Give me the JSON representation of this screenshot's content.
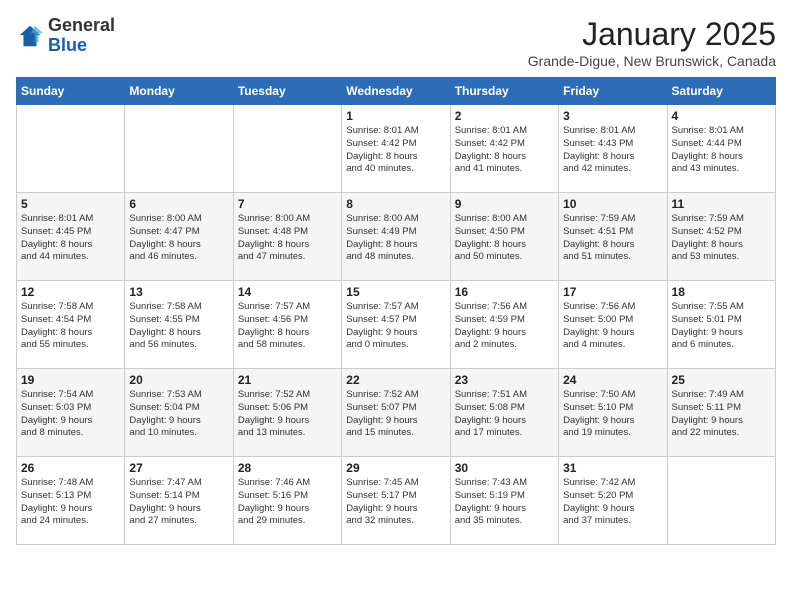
{
  "header": {
    "logo_general": "General",
    "logo_blue": "Blue",
    "month_title": "January 2025",
    "location": "Grande-Digue, New Brunswick, Canada"
  },
  "weekdays": [
    "Sunday",
    "Monday",
    "Tuesday",
    "Wednesday",
    "Thursday",
    "Friday",
    "Saturday"
  ],
  "weeks": [
    [
      {
        "day": "",
        "text": ""
      },
      {
        "day": "",
        "text": ""
      },
      {
        "day": "",
        "text": ""
      },
      {
        "day": "1",
        "text": "Sunrise: 8:01 AM\nSunset: 4:42 PM\nDaylight: 8 hours\nand 40 minutes."
      },
      {
        "day": "2",
        "text": "Sunrise: 8:01 AM\nSunset: 4:42 PM\nDaylight: 8 hours\nand 41 minutes."
      },
      {
        "day": "3",
        "text": "Sunrise: 8:01 AM\nSunset: 4:43 PM\nDaylight: 8 hours\nand 42 minutes."
      },
      {
        "day": "4",
        "text": "Sunrise: 8:01 AM\nSunset: 4:44 PM\nDaylight: 8 hours\nand 43 minutes."
      }
    ],
    [
      {
        "day": "5",
        "text": "Sunrise: 8:01 AM\nSunset: 4:45 PM\nDaylight: 8 hours\nand 44 minutes."
      },
      {
        "day": "6",
        "text": "Sunrise: 8:00 AM\nSunset: 4:47 PM\nDaylight: 8 hours\nand 46 minutes."
      },
      {
        "day": "7",
        "text": "Sunrise: 8:00 AM\nSunset: 4:48 PM\nDaylight: 8 hours\nand 47 minutes."
      },
      {
        "day": "8",
        "text": "Sunrise: 8:00 AM\nSunset: 4:49 PM\nDaylight: 8 hours\nand 48 minutes."
      },
      {
        "day": "9",
        "text": "Sunrise: 8:00 AM\nSunset: 4:50 PM\nDaylight: 8 hours\nand 50 minutes."
      },
      {
        "day": "10",
        "text": "Sunrise: 7:59 AM\nSunset: 4:51 PM\nDaylight: 8 hours\nand 51 minutes."
      },
      {
        "day": "11",
        "text": "Sunrise: 7:59 AM\nSunset: 4:52 PM\nDaylight: 8 hours\nand 53 minutes."
      }
    ],
    [
      {
        "day": "12",
        "text": "Sunrise: 7:58 AM\nSunset: 4:54 PM\nDaylight: 8 hours\nand 55 minutes."
      },
      {
        "day": "13",
        "text": "Sunrise: 7:58 AM\nSunset: 4:55 PM\nDaylight: 8 hours\nand 56 minutes."
      },
      {
        "day": "14",
        "text": "Sunrise: 7:57 AM\nSunset: 4:56 PM\nDaylight: 8 hours\nand 58 minutes."
      },
      {
        "day": "15",
        "text": "Sunrise: 7:57 AM\nSunset: 4:57 PM\nDaylight: 9 hours\nand 0 minutes."
      },
      {
        "day": "16",
        "text": "Sunrise: 7:56 AM\nSunset: 4:59 PM\nDaylight: 9 hours\nand 2 minutes."
      },
      {
        "day": "17",
        "text": "Sunrise: 7:56 AM\nSunset: 5:00 PM\nDaylight: 9 hours\nand 4 minutes."
      },
      {
        "day": "18",
        "text": "Sunrise: 7:55 AM\nSunset: 5:01 PM\nDaylight: 9 hours\nand 6 minutes."
      }
    ],
    [
      {
        "day": "19",
        "text": "Sunrise: 7:54 AM\nSunset: 5:03 PM\nDaylight: 9 hours\nand 8 minutes."
      },
      {
        "day": "20",
        "text": "Sunrise: 7:53 AM\nSunset: 5:04 PM\nDaylight: 9 hours\nand 10 minutes."
      },
      {
        "day": "21",
        "text": "Sunrise: 7:52 AM\nSunset: 5:06 PM\nDaylight: 9 hours\nand 13 minutes."
      },
      {
        "day": "22",
        "text": "Sunrise: 7:52 AM\nSunset: 5:07 PM\nDaylight: 9 hours\nand 15 minutes."
      },
      {
        "day": "23",
        "text": "Sunrise: 7:51 AM\nSunset: 5:08 PM\nDaylight: 9 hours\nand 17 minutes."
      },
      {
        "day": "24",
        "text": "Sunrise: 7:50 AM\nSunset: 5:10 PM\nDaylight: 9 hours\nand 19 minutes."
      },
      {
        "day": "25",
        "text": "Sunrise: 7:49 AM\nSunset: 5:11 PM\nDaylight: 9 hours\nand 22 minutes."
      }
    ],
    [
      {
        "day": "26",
        "text": "Sunrise: 7:48 AM\nSunset: 5:13 PM\nDaylight: 9 hours\nand 24 minutes."
      },
      {
        "day": "27",
        "text": "Sunrise: 7:47 AM\nSunset: 5:14 PM\nDaylight: 9 hours\nand 27 minutes."
      },
      {
        "day": "28",
        "text": "Sunrise: 7:46 AM\nSunset: 5:16 PM\nDaylight: 9 hours\nand 29 minutes."
      },
      {
        "day": "29",
        "text": "Sunrise: 7:45 AM\nSunset: 5:17 PM\nDaylight: 9 hours\nand 32 minutes."
      },
      {
        "day": "30",
        "text": "Sunrise: 7:43 AM\nSunset: 5:19 PM\nDaylight: 9 hours\nand 35 minutes."
      },
      {
        "day": "31",
        "text": "Sunrise: 7:42 AM\nSunset: 5:20 PM\nDaylight: 9 hours\nand 37 minutes."
      },
      {
        "day": "",
        "text": ""
      }
    ]
  ]
}
